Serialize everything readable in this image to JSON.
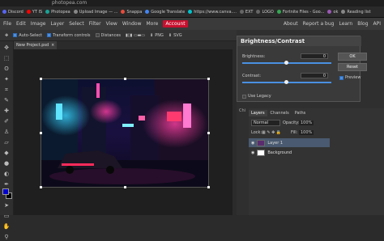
{
  "browser": {
    "url": "photopea.com",
    "bookmarks": [
      {
        "label": "Discord",
        "color": "#5865f2"
      },
      {
        "label": "YT IS",
        "color": "#ff0000"
      },
      {
        "label": "Photopea",
        "color": "#18a497"
      },
      {
        "label": "Upload Image — ...",
        "color": "#888888"
      },
      {
        "label": "Snappa",
        "color": "#e74c3c"
      },
      {
        "label": "Google Translate",
        "color": "#4285f4"
      },
      {
        "label": "https://www.canva....",
        "color": "#00c4cc"
      },
      {
        "label": "EXT",
        "color": "#666666"
      },
      {
        "label": "LOGO",
        "color": "#666666"
      },
      {
        "label": "Fortnite Files - Goo...",
        "color": "#34a853"
      },
      {
        "label": "ok",
        "color": "#9b59b6"
      },
      {
        "label": "Reading list",
        "color": "#888888"
      }
    ]
  },
  "menubar": {
    "items": [
      "File",
      "Edit",
      "Image",
      "Layer",
      "Select",
      "Filter",
      "View",
      "Window",
      "More",
      "Account"
    ],
    "right_items": [
      "About",
      "Report a bug",
      "Learn",
      "Blog",
      "API"
    ]
  },
  "options": {
    "auto_select": "Auto-Select",
    "transform_controls": "Transform controls",
    "distances": "Distances",
    "png": "PNG",
    "svg": "SVG"
  },
  "document": {
    "tab_label": "New Project.psd",
    "tab_close": "×"
  },
  "dialog": {
    "title": "Brightness/Contrast",
    "brightness_label": "Brightness:",
    "brightness_value": "0",
    "contrast_label": "Contrast:",
    "contrast_value": "0",
    "use_legacy": "Use Legacy",
    "ok": "OK",
    "reset": "Reset",
    "preview": "Preview"
  },
  "layers_panel": {
    "side_label": "Chi",
    "tabs": [
      "Layers",
      "Channels",
      "Paths"
    ],
    "blend_mode": "Normal",
    "opacity_label": "Opacity:",
    "opacity_value": "100%",
    "lock_label": "Lock:",
    "fill_label": "Fill:",
    "fill_value": "100%",
    "layers": [
      {
        "name": "Layer 1"
      },
      {
        "name": "Background"
      }
    ]
  }
}
